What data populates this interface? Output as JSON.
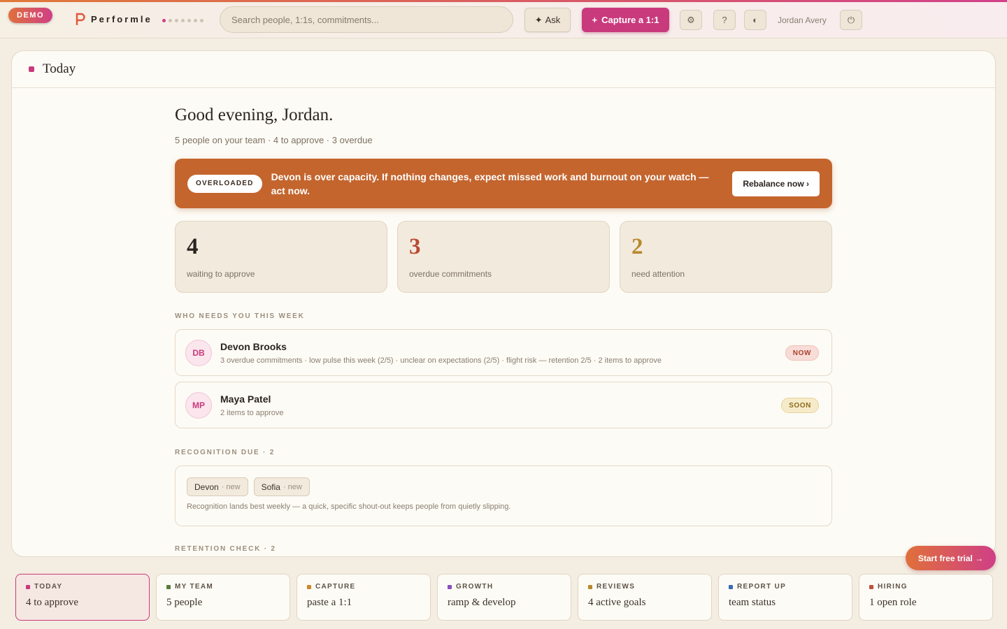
{
  "header": {
    "demo_label": "DEMO",
    "brand": "Performle",
    "search_placeholder": "Search people, 1:1s, commitments...",
    "ask_label": "Ask",
    "capture_label": "Capture a 1:1",
    "user_name": "Jordan Avery",
    "accent": "#c93a7d"
  },
  "page": {
    "title": "Today",
    "greeting": "Good evening, Jordan.",
    "subtitle": "5 people on your team · 4 to approve · 3 overdue"
  },
  "alert": {
    "tag": "OVERLOADED",
    "text": "Devon is over capacity. If nothing changes, expect missed work and burnout on your watch — act now.",
    "action": "Rebalance now ›",
    "color": "#c4652e"
  },
  "stats": [
    {
      "value": "4",
      "label": "waiting to approve",
      "color": "#2a2420"
    },
    {
      "value": "3",
      "label": "overdue commitments",
      "color": "#b84a33"
    },
    {
      "value": "2",
      "label": "need attention",
      "color": "#b8892c"
    }
  ],
  "who_needs_you": {
    "label": "WHO NEEDS YOU THIS WEEK",
    "people": [
      {
        "initials": "DB",
        "name": "Devon Brooks",
        "detail": "3 overdue commitments · low pulse this week (2/5) · unclear on expectations (2/5) · flight risk — retention 2/5 · 2 items to approve",
        "status": "NOW"
      },
      {
        "initials": "MP",
        "name": "Maya Patel",
        "detail": "2 items to approve",
        "status": "SOON"
      }
    ]
  },
  "recognition": {
    "label": "RECOGNITION DUE · 2",
    "chips": [
      {
        "name": "Devon",
        "tag": "· new"
      },
      {
        "name": "Sofia",
        "tag": "· new"
      }
    ],
    "note": "Recognition lands best weekly — a quick, specific shout-out keeps people from quietly slipping."
  },
  "retention": {
    "label": "RETENTION CHECK · 2"
  },
  "trial_label": "Start free trial →",
  "tabs": [
    {
      "label": "TODAY",
      "value": "4 to approve",
      "color": "#c93a7d"
    },
    {
      "label": "MY TEAM",
      "value": "5 people",
      "color": "#5a7a3a"
    },
    {
      "label": "CAPTURE",
      "value": "paste a 1:1",
      "color": "#c98a2a"
    },
    {
      "label": "GROWTH",
      "value": "ramp & develop",
      "color": "#8a4fc0"
    },
    {
      "label": "REVIEWS",
      "value": "4 active goals",
      "color": "#b8892c"
    },
    {
      "label": "REPORT UP",
      "value": "team status",
      "color": "#3a6ab8"
    },
    {
      "label": "HIRING",
      "value": "1 open role",
      "color": "#c0503a"
    }
  ]
}
